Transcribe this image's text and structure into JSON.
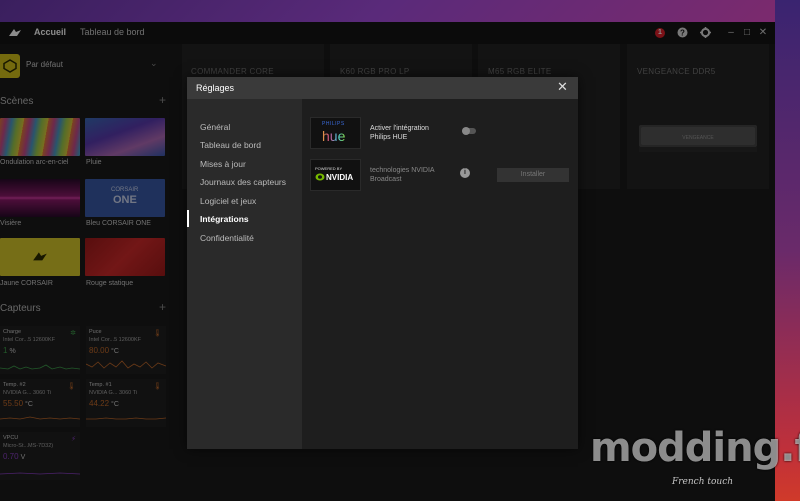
{
  "titlebar": {
    "home": "Accueil",
    "dashboard": "Tableau de bord",
    "alert_count": "1"
  },
  "sidebar": {
    "profile": "Par défaut",
    "scenes_title": "Scènes",
    "scenes": [
      {
        "label": "Ondulation arc-en-ciel",
        "icon": "rainbow-wave"
      },
      {
        "label": "Pluie",
        "icon": "rain"
      },
      {
        "label": "Visière",
        "icon": "visor"
      },
      {
        "label": "Bleu CORSAIR ONE",
        "icon": "corsair-one"
      },
      {
        "label": "Jaune CORSAIR",
        "icon": "corsair-logo"
      },
      {
        "label": "Rouge statique",
        "icon": "static-red"
      }
    ],
    "scene_tile_text": {
      "corsair_one_top": "CORSAIR",
      "corsair_one_bottom": "ONE"
    },
    "sensors_title": "Capteurs",
    "sensors": [
      {
        "title": "Charge",
        "sub": "Intel Cor...5 12600KF",
        "value": "1",
        "unit": "%",
        "color": "#3fa34d",
        "icon": "gear-icon"
      },
      {
        "title": "Puce",
        "sub": "Intel Cor...5 12600KF",
        "value": "80.00",
        "unit": "°C",
        "color": "#c46a2a",
        "icon": "thermometer-icon"
      },
      {
        "title": "Temp. #2",
        "sub": "NVIDIA G... 3060 Ti",
        "value": "55.50",
        "unit": "°C",
        "color": "#c46a2a",
        "icon": "thermometer-icon"
      },
      {
        "title": "Temp. #1",
        "sub": "NVIDIA G... 3060 Ti",
        "value": "44.22",
        "unit": "°C",
        "color": "#c46a2a",
        "icon": "thermometer-icon"
      },
      {
        "title": "VPCU",
        "sub": "Micro-St...MS-7D32)",
        "value": "0.70",
        "unit": "V",
        "color": "#8a3fc4",
        "icon": "bolt-icon"
      }
    ]
  },
  "devices": [
    "COMMANDER CORE",
    "K60 RGB PRO LP",
    "M65 RGB ELITE",
    "VENGEANCE DDR5"
  ],
  "modal": {
    "title": "Réglages",
    "nav": [
      "Général",
      "Tableau de bord",
      "Mises à jour",
      "Journaux des capteurs",
      "Logiciel et jeux",
      "Intégrations",
      "Confidentialité"
    ],
    "active_index": 5,
    "integrations": [
      {
        "logo_top": "PHILIPS",
        "logo_main": "hue",
        "text_line1": "Activer l'intégration",
        "text_line2": "Philips HUE",
        "toggle": false
      },
      {
        "logo_top": "POWERED BY",
        "logo_main": "NVIDIA",
        "text_line1": "technologies NVIDIA",
        "text_line2": "Broadcast",
        "button": "Installer"
      }
    ]
  },
  "watermark": {
    "main": "modding.fr",
    "sub": "French touch"
  }
}
